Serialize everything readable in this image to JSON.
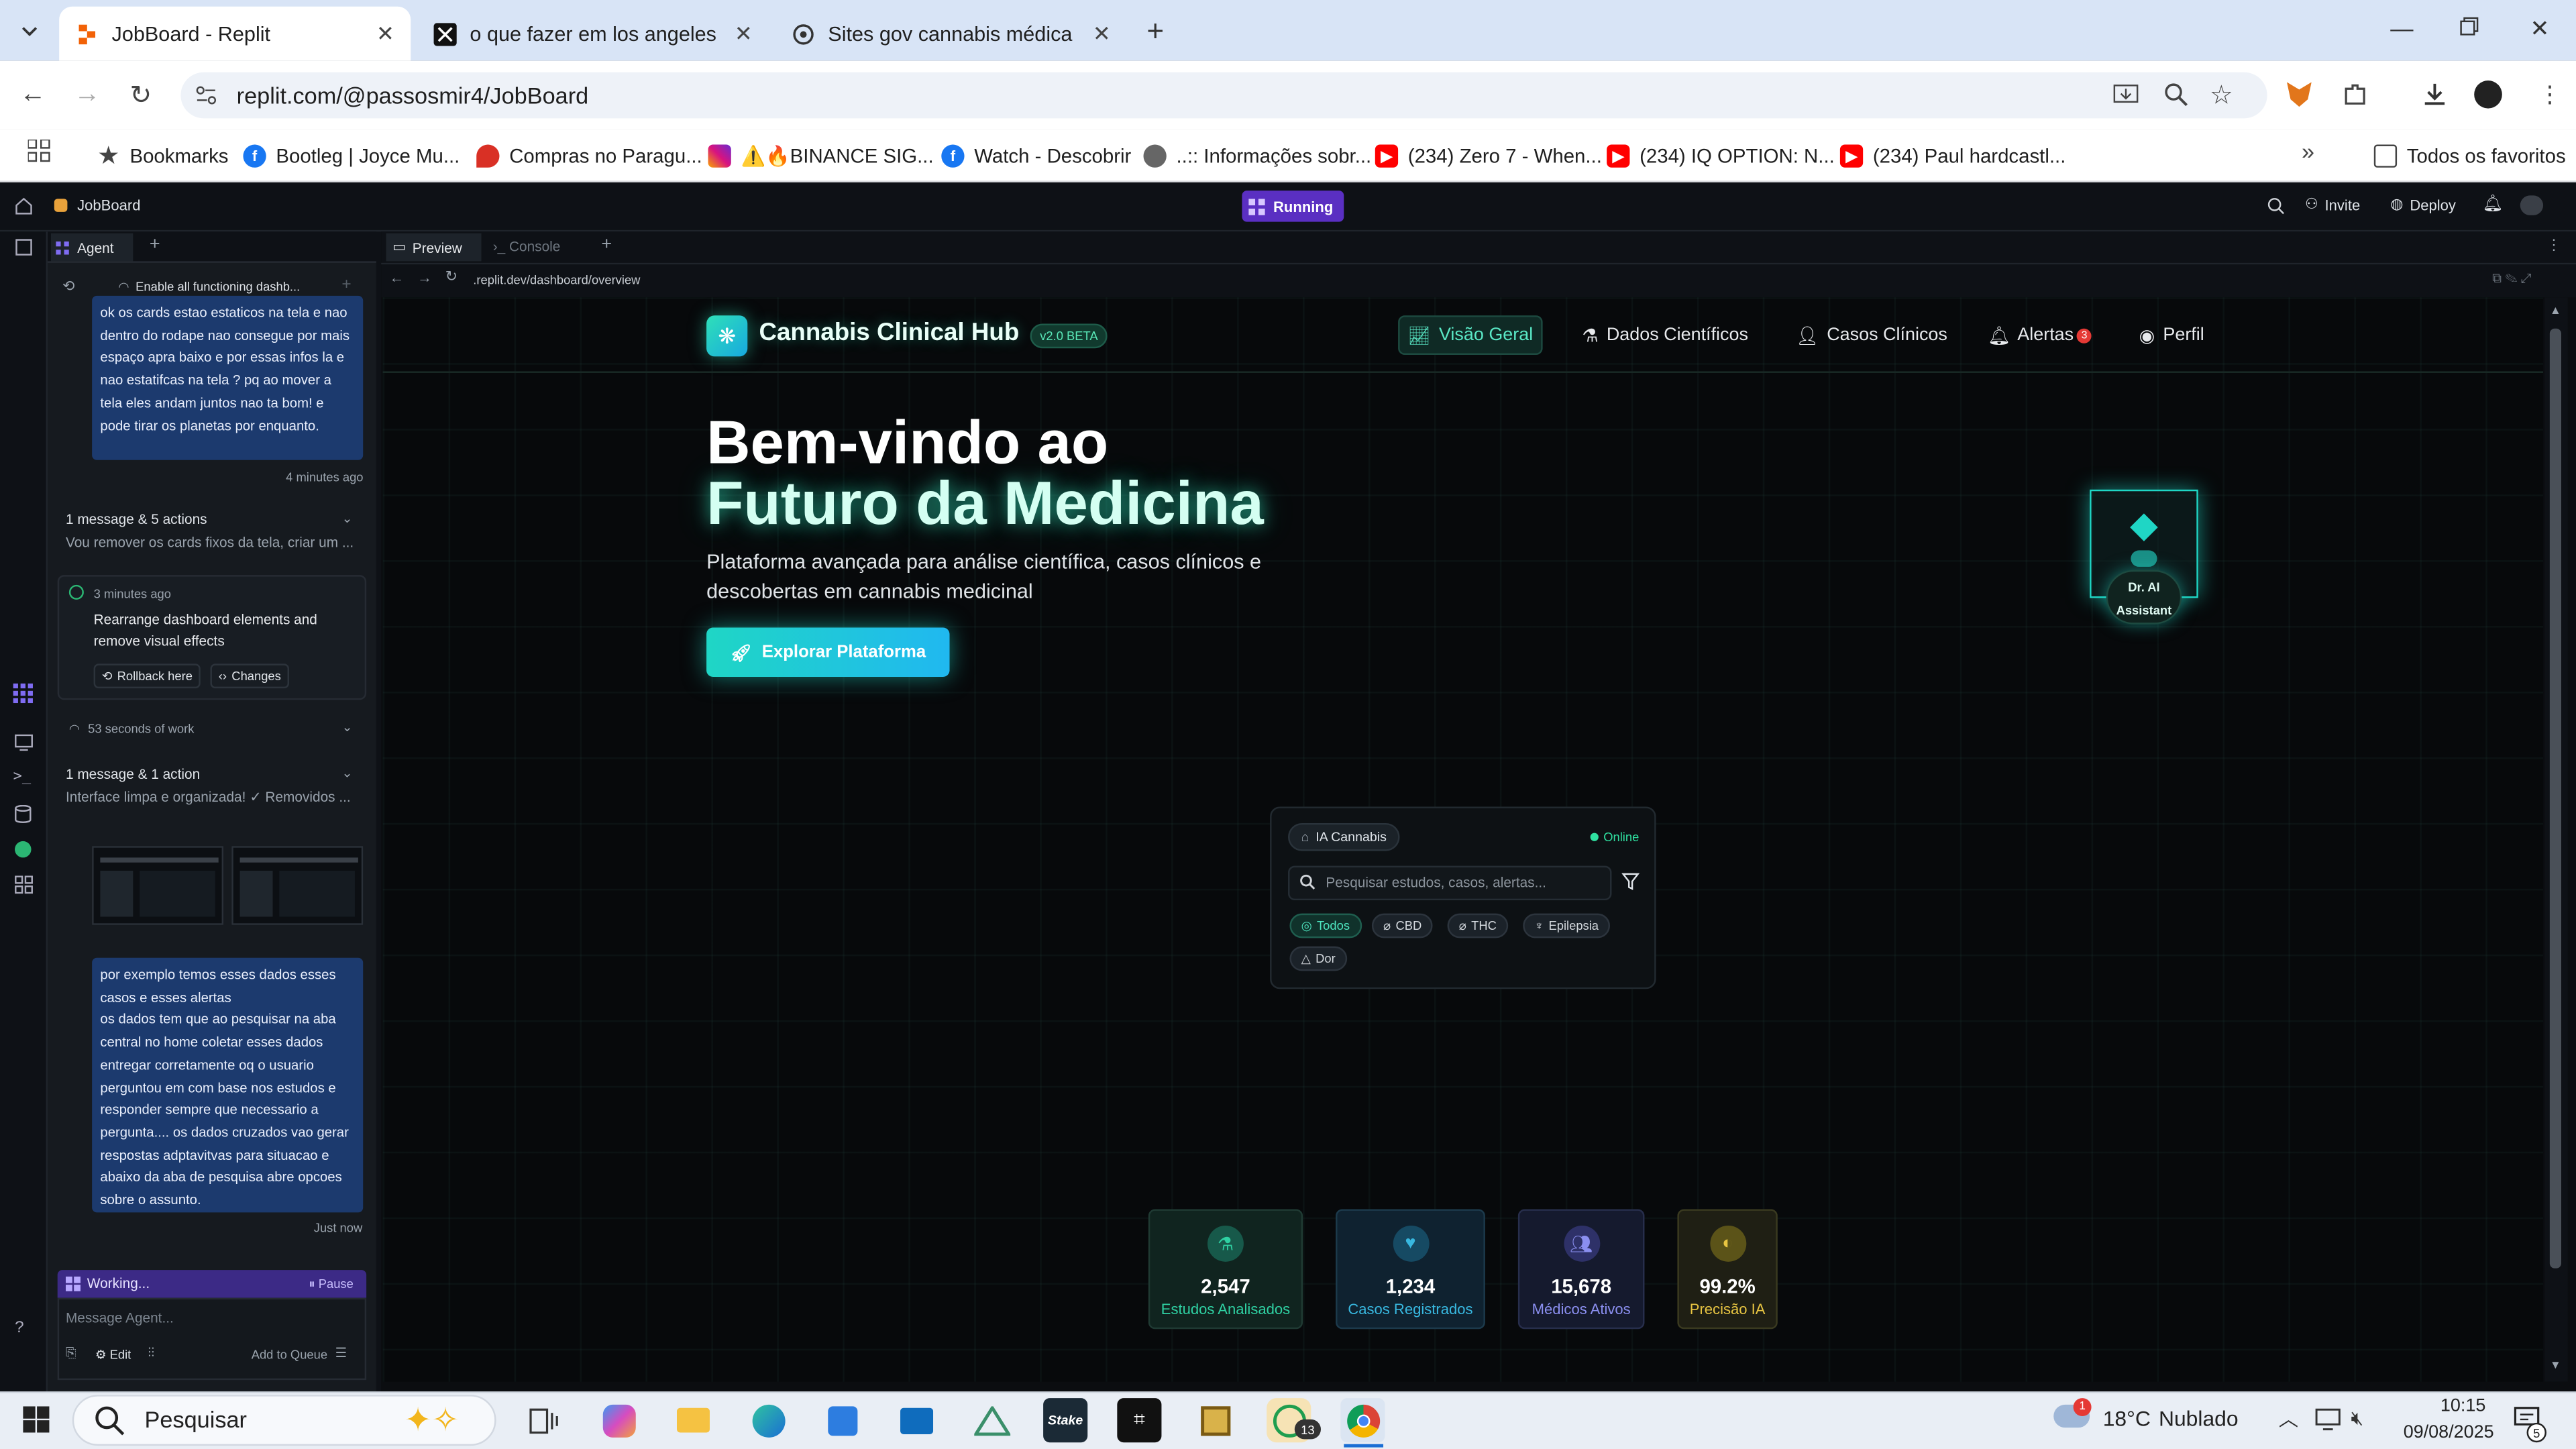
{
  "browser": {
    "tabs": [
      {
        "title": "JobBoard - Replit",
        "active": true
      },
      {
        "title": "o que fazer em los angeles",
        "active": false
      },
      {
        "title": "Sites gov cannabis médica",
        "active": false
      }
    ],
    "url": "replit.com/@passosmir4/JobBoard",
    "bookmarks": [
      {
        "label": "Bookmarks",
        "icon": "star-icon"
      },
      {
        "label": "Bootleg | Joyce Mu...",
        "icon": "facebook-icon"
      },
      {
        "label": "Compras no Paragu...",
        "icon": "pin-icon"
      },
      {
        "label": "⚠️🔥BINANCE SIG...",
        "icon": "instagram-icon"
      },
      {
        "label": "Watch - Descobrir",
        "icon": "facebook-icon"
      },
      {
        "label": "..:: Informações sobr...",
        "icon": "globe-icon"
      },
      {
        "label": "(234) Zero 7 - When...",
        "icon": "youtube-icon"
      },
      {
        "label": "(234) IQ OPTION: N...",
        "icon": "youtube-icon"
      },
      {
        "label": "(234) Paul hardcastl...",
        "icon": "youtube-icon"
      }
    ],
    "all_bookmarks": "Todos os favoritos"
  },
  "replit": {
    "project": "JobBoard",
    "status": "Running",
    "invite": "Invite",
    "deploy": "Deploy",
    "agent_tab": "Agent",
    "preview_tab": "Preview",
    "console_tab": "Console",
    "thread_title": "Enable all functioning dashb...",
    "preview_url": ".replit.dev/dashboard/overview"
  },
  "agent": {
    "msg1": "ok os cards estao estaticos na tela e nao dentro do rodape nao consegue por mais espaço apra baixo e por essas infos la e nao estatifcas na tela ? pq ao mover a tela eles andam juntos nao ta bom! e pode tirar os planetas por enquanto.",
    "msg1_time": "4 minutes ago",
    "group1_title": "1 message & 5 actions",
    "group1_preview": "Vou remover os cards fixos da tela, criar um ...",
    "checkpoint_time": "3 minutes ago",
    "checkpoint_title": "Rearrange dashboard elements and remove visual effects",
    "rollback": "Rollback here",
    "changes": "Changes",
    "work_time": "53 seconds of work",
    "group2_title": "1 message & 1 action",
    "group2_preview": "Interface limpa e organizada! ✓ Removidos ...",
    "msg2": "por exemplo temos esses dados esses casos e esses alertas\nos dados tem que ao pesquisar na aba central no home coletar esses dados entregar corretamente oq o usuario perguntou em com base nos estudos e responder sempre que necessario a pergunta.... os dados cruzados vao gerar respostas adptavitvas para situacao e abaixo da aba de pesquisa abre opcoes sobre o assunto.",
    "msg2_time": "Just now",
    "working": "Working...",
    "pause": "Pause",
    "input_placeholder": "Message Agent...",
    "edit": "Edit",
    "add_queue": "Add to Queue"
  },
  "site": {
    "brand": "Cannabis Clinical Hub",
    "version": "v2.0 BETA",
    "nav": [
      {
        "label": "Visão Geral",
        "active": true,
        "icon": "chart-icon"
      },
      {
        "label": "Dados Científicos",
        "active": false,
        "icon": "flask-icon"
      },
      {
        "label": "Casos Clínicos",
        "active": false,
        "icon": "user-icon"
      },
      {
        "label": "Alertas",
        "active": false,
        "icon": "bell-icon",
        "badge": "3"
      },
      {
        "label": "Perfil",
        "active": false,
        "icon": "user-circle-icon"
      }
    ],
    "hero_line1": "Bem-vindo ao",
    "hero_line2": "Futuro da Medicina",
    "subtitle": "Plataforma avançada para análise científica, casos clínicos e descobertas em cannabis medicinal",
    "cta": "Explorar Plataforma",
    "assistant_line1": "Dr. AI",
    "assistant_line2": "Assistant",
    "search_card": {
      "label": "IA Cannabis",
      "status": "Online",
      "placeholder": "Pesquisar estudos, casos, alertas...",
      "filters": [
        "Todos",
        "CBD",
        "THC",
        "Epilepsia",
        "Dor"
      ]
    },
    "stats": [
      {
        "value": "2,547",
        "label": "Estudos Analisados",
        "color": "#2fd1a3"
      },
      {
        "value": "1,234",
        "label": "Casos Registrados",
        "color": "#38b8e0"
      },
      {
        "value": "15,678",
        "label": "Médicos Ativos",
        "color": "#8b8ff0"
      },
      {
        "value": "99.2%",
        "label": "Precisão IA",
        "color": "#e8c542"
      }
    ]
  },
  "taskbar": {
    "search": "Pesquisar",
    "weather_temp": "18°C",
    "weather_desc": "Nublado",
    "time": "10:15",
    "date": "09/08/2025",
    "whatsapp_badge": "13",
    "notif_badge": "5",
    "weather_badge": "1"
  }
}
